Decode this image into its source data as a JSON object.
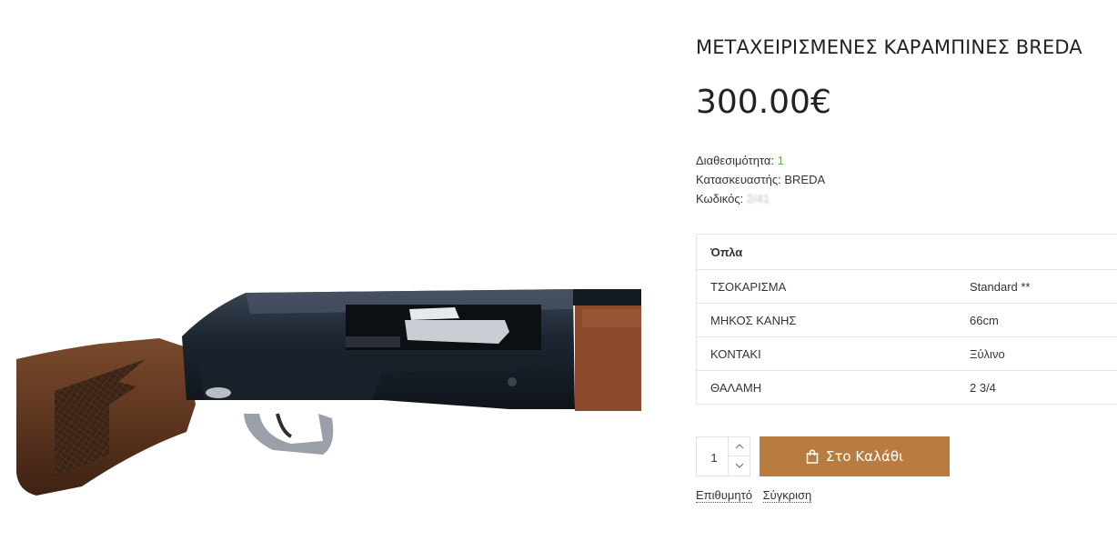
{
  "product": {
    "title": "ΜΕΤΑΧΕΙΡΙΣΜΕΝΕΣ ΚΑΡΑΜΠΙΝΕΣ BREDA",
    "price": "300.00€",
    "image_icon": "shotgun-image"
  },
  "meta": {
    "availability_label": "Διαθεσιμότητα:",
    "availability_value": "1",
    "manufacturer_label": "Κατασκευαστής:",
    "manufacturer_value": "BREDA",
    "sku_label": "Κωδικός:",
    "sku_value": "2/41"
  },
  "specs": {
    "group": "Όπλα",
    "rows": [
      {
        "key": "ΤΣΟΚΑΡΙΣΜΑ",
        "value": "Standard **"
      },
      {
        "key": "ΜΗΚΟΣ ΚΑΝΗΣ",
        "value": "66cm"
      },
      {
        "key": "ΚΟΝΤΑΚΙ",
        "value": "Ξύλινο"
      },
      {
        "key": "ΘΑΛΑΜΗ",
        "value": "2 3/4"
      }
    ]
  },
  "cart": {
    "quantity": "1",
    "button_label": "Στο Καλάθι",
    "button_icon": "shopping-bag-icon",
    "color": "#b97c3e"
  },
  "links": {
    "wishlist": "Επιθυμητό",
    "compare": "Σύγκριση"
  }
}
